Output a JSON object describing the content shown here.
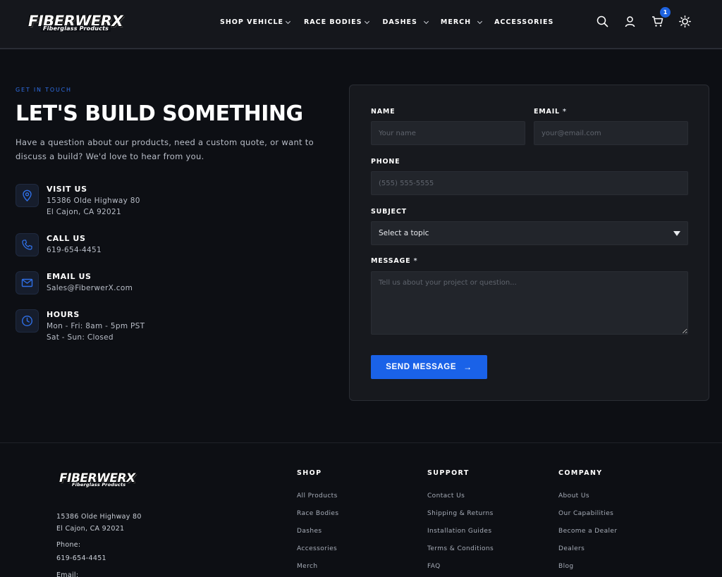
{
  "brand": {
    "name": "FIBERWERX",
    "tagline": "Fiberglass Products"
  },
  "nav": {
    "items": [
      {
        "label": "SHOP VEHICLE",
        "has_dropdown": true
      },
      {
        "label": "RACE BODIES",
        "has_dropdown": true
      },
      {
        "label": "DASHES",
        "has_dropdown": true
      },
      {
        "label": "MERCH",
        "has_dropdown": true
      },
      {
        "label": "ACCESSORIES",
        "has_dropdown": false
      }
    ]
  },
  "header_icons": {
    "search": "search-icon",
    "account": "user-icon",
    "cart": "cart-icon",
    "theme": "sun-icon",
    "cart_count": "1"
  },
  "contact": {
    "eyebrow": "GET IN TOUCH",
    "heading": "LET'S BUILD SOMETHING",
    "lede": "Have a question about our products, need a custom quote, or want to discuss a build? We'd love to hear from you.",
    "items": [
      {
        "icon": "map-pin-icon",
        "title": "VISIT US",
        "lines": [
          "15386 Olde Highway 80",
          "El Cajon, CA 92021"
        ]
      },
      {
        "icon": "phone-icon",
        "title": "CALL US",
        "lines": [
          "619-654-4451"
        ]
      },
      {
        "icon": "mail-icon",
        "title": "EMAIL US",
        "lines": [
          "Sales@FiberwerX.com"
        ]
      },
      {
        "icon": "clock-icon",
        "title": "HOURS",
        "lines": [
          "Mon - Fri: 8am - 5pm PST",
          "Sat - Sun: Closed"
        ]
      }
    ]
  },
  "form": {
    "name_label": "NAME",
    "name_placeholder": "Your name",
    "email_label": "EMAIL",
    "email_placeholder": "your@email.com",
    "phone_label": "PHONE",
    "phone_placeholder": "(555) 555-5555",
    "subject_label": "SUBJECT",
    "subject_value": "Select a topic",
    "message_label": "MESSAGE",
    "message_placeholder": "Tell us about your project or question...",
    "required_mark": "*",
    "submit_label": "SEND MESSAGE",
    "submit_arrow": "→"
  },
  "footer": {
    "address_lines": [
      "15386 Olde Highway 80",
      "El Cajon, CA 92021"
    ],
    "phone_label": "Phone:",
    "phone": "619-654-4451",
    "email_label": "Email:",
    "columns": [
      {
        "title": "SHOP",
        "links": [
          "All Products",
          "Race Bodies",
          "Dashes",
          "Accessories",
          "Merch"
        ]
      },
      {
        "title": "SUPPORT",
        "links": [
          "Contact Us",
          "Shipping & Returns",
          "Installation Guides",
          "Terms & Conditions",
          "FAQ"
        ]
      },
      {
        "title": "COMPANY",
        "links": [
          "About Us",
          "Our Capabilities",
          "Become a Dealer",
          "Dealers",
          "Blog"
        ]
      }
    ]
  },
  "colors": {
    "accent": "#1a62e8",
    "background": "#0d0f14",
    "card": "#17191e"
  }
}
